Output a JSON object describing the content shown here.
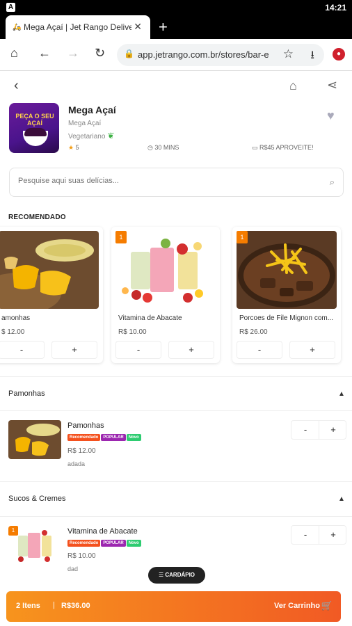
{
  "status_bar": {
    "time": "14:21",
    "notif_icon": "A"
  },
  "browser": {
    "tab_title": "Mega Açaí | Jet Rango Delive",
    "url": "app.jetrango.com.br/stores/bar-e"
  },
  "store": {
    "logo_text": "PEÇA O SEU AÇAÍ",
    "name": "Mega Açaí",
    "subtitle": "Mega Açaí",
    "category": "Vegetariano",
    "rating": "5",
    "time": "30 MINS",
    "promo": "R$45 APROVEITE!"
  },
  "search": {
    "placeholder": "Pesquise aqui suas delícias..."
  },
  "recommended": {
    "title": "RECOMENDADO",
    "cards": [
      {
        "name": "amonhas",
        "price": "$ 12.00",
        "badge": "",
        "minus": "-",
        "plus": "+"
      },
      {
        "name": "Vitamina de Abacate",
        "price": "R$ 10.00",
        "badge": "1",
        "minus": "-",
        "plus": "+"
      },
      {
        "name": "Porcoes de File Mignon com...",
        "price": "R$ 26.00",
        "badge": "1",
        "minus": "-",
        "plus": "+"
      }
    ]
  },
  "sections": [
    {
      "title": "Pamonhas",
      "item": {
        "name": "Pamonhas",
        "tags": [
          "Recomendado",
          "POPULAR",
          "Novo"
        ],
        "price": "R$ 12.00",
        "desc": "adada",
        "badge": ""
      }
    },
    {
      "title": "Sucos & Cremes",
      "item": {
        "name": "Vitamina de Abacate",
        "tags": [
          "Recomendado",
          "POPULAR",
          "Novo"
        ],
        "price": "R$ 10.00",
        "desc": "dad",
        "badge": "1"
      }
    }
  ],
  "stepper": {
    "minus": "-",
    "plus": "+"
  },
  "menu_button": "CARDÁPIO",
  "cart": {
    "count": "2 Itens",
    "separator": "|",
    "total": "R$36.00",
    "action": "Ver Carrinho"
  },
  "colors": {
    "accent": "#f57c00",
    "cart_start": "#f7941d",
    "cart_end": "#f15a24"
  }
}
